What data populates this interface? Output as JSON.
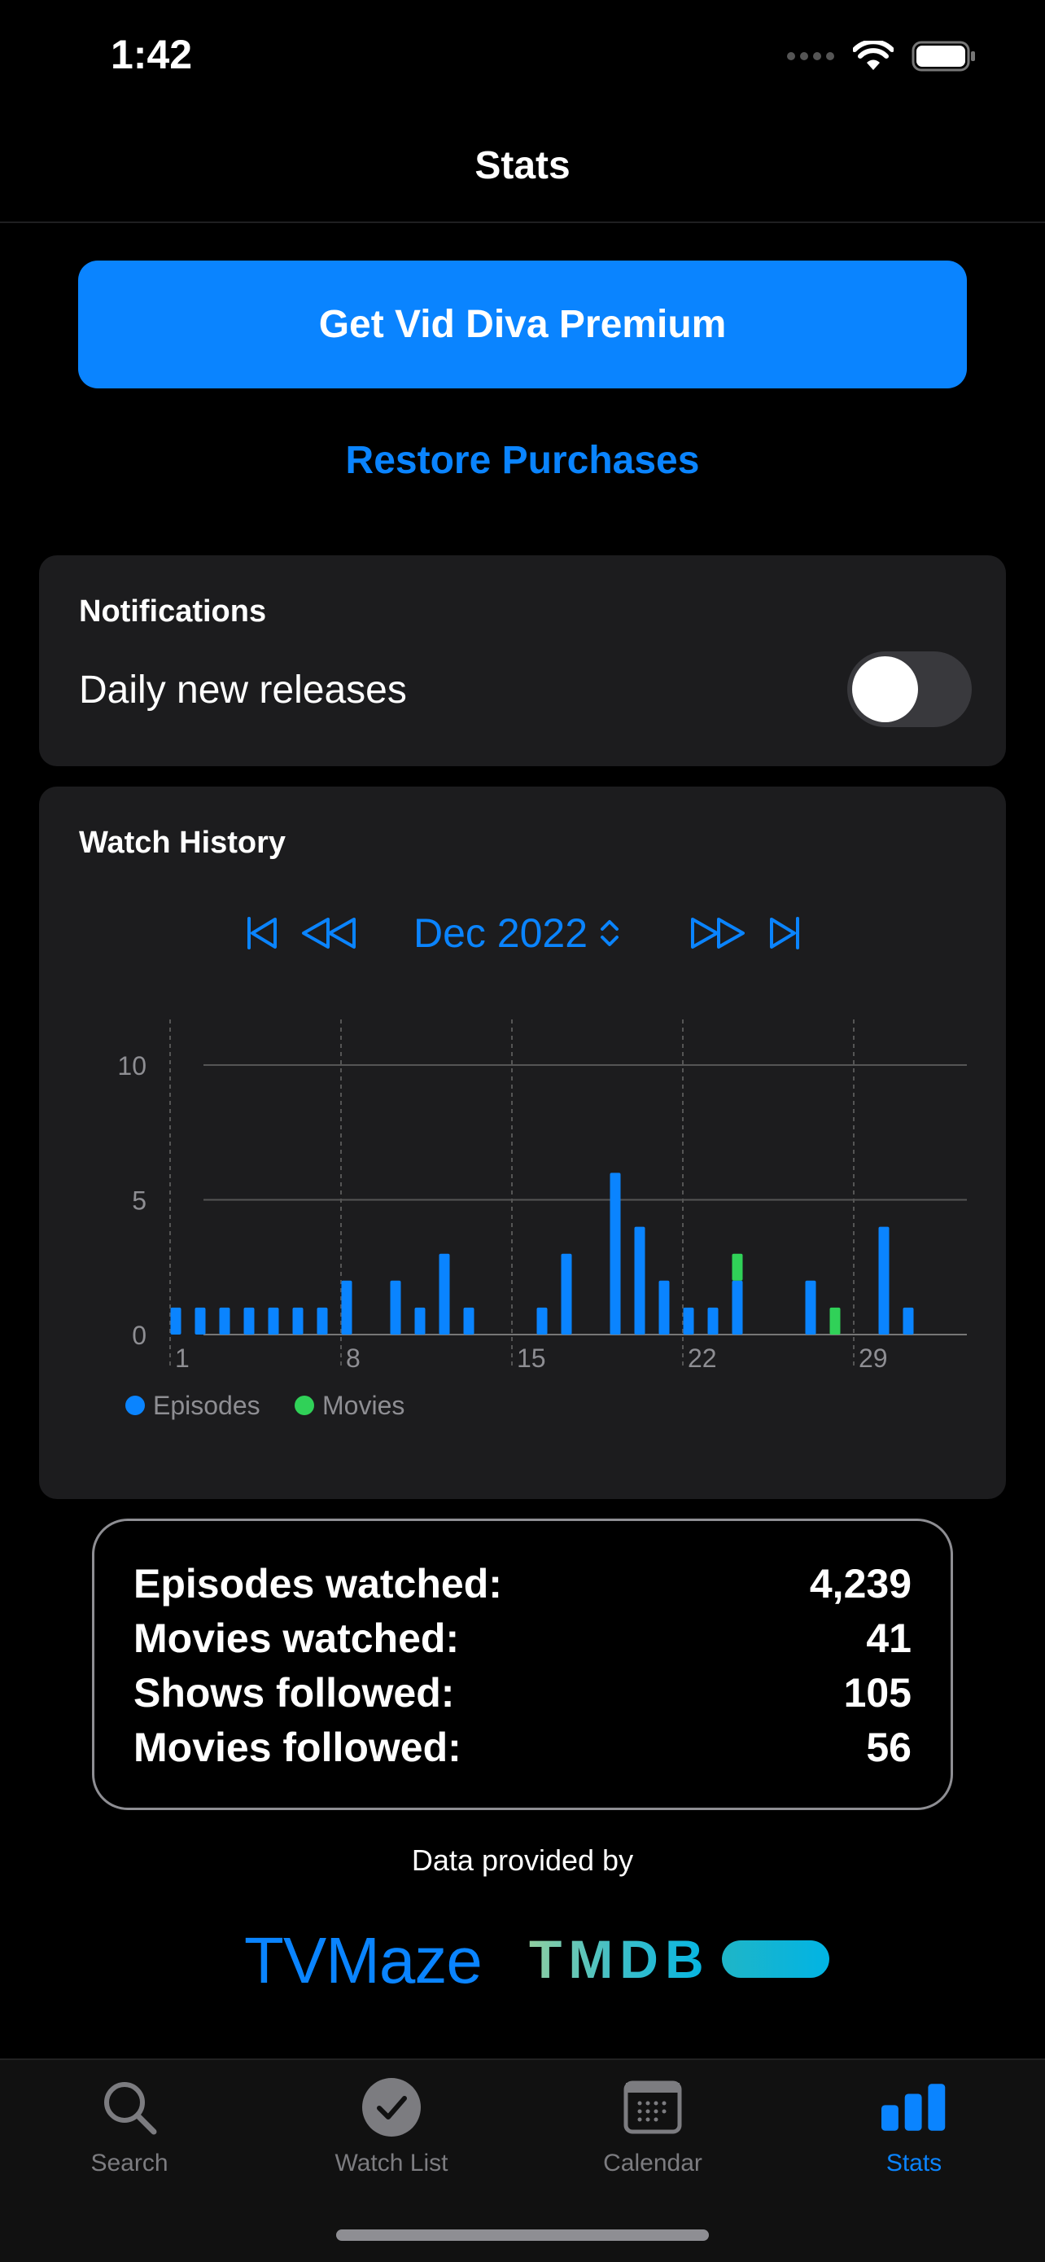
{
  "status_bar": {
    "time": "1:42"
  },
  "nav": {
    "title": "Stats"
  },
  "premium": {
    "button_label": "Get Vid Diva Premium",
    "restore_label": "Restore Purchases"
  },
  "notifications": {
    "heading": "Notifications",
    "daily_label": "Daily new releases",
    "daily_enabled": false
  },
  "watch_history": {
    "heading": "Watch History",
    "month": "Dec 2022",
    "legend": [
      {
        "name": "Episodes",
        "color": "#0a84ff"
      },
      {
        "name": "Movies",
        "color": "#30d158"
      }
    ]
  },
  "chart_data": {
    "type": "bar",
    "stacked": true,
    "x": [
      1,
      2,
      3,
      4,
      5,
      6,
      7,
      8,
      9,
      10,
      11,
      12,
      13,
      14,
      15,
      16,
      17,
      18,
      19,
      20,
      21,
      22,
      23,
      24,
      25,
      26,
      27,
      28,
      29,
      30,
      31
    ],
    "x_ticks": [
      "1",
      "8",
      "15",
      "22",
      "29"
    ],
    "y_ticks": [
      "0",
      "5",
      "10"
    ],
    "ylim": [
      0,
      10
    ],
    "series": [
      {
        "name": "Episodes",
        "color": "#0a84ff",
        "values": [
          1,
          1,
          1,
          1,
          1,
          1,
          1,
          2,
          0,
          2,
          1,
          3,
          1,
          0,
          0,
          1,
          3,
          0,
          6,
          4,
          2,
          1,
          1,
          2,
          0,
          0,
          2,
          0,
          0,
          4,
          1
        ]
      },
      {
        "name": "Movies",
        "color": "#30d158",
        "values": [
          0,
          0,
          0,
          0,
          0,
          0,
          0,
          0,
          0,
          0,
          0,
          0,
          0,
          0,
          0,
          0,
          0,
          0,
          0,
          0,
          0,
          0,
          0,
          1,
          0,
          0,
          0,
          1,
          0,
          0,
          0
        ]
      }
    ],
    "legend_position": "bottom-left",
    "grid": true
  },
  "totals": [
    {
      "label": "Episodes watched:",
      "value": "4,239"
    },
    {
      "label": "Movies watched:",
      "value": "41"
    },
    {
      "label": "Shows followed:",
      "value": "105"
    },
    {
      "label": "Movies followed:",
      "value": "56"
    }
  ],
  "credits": {
    "label": "Data provided by",
    "tvmaze": "TVMaze",
    "tmdb": "TMDB"
  },
  "tabs": [
    {
      "label": "Search",
      "icon": "search-icon",
      "active": false
    },
    {
      "label": "Watch List",
      "icon": "checkmark-circle-icon",
      "active": false
    },
    {
      "label": "Calendar",
      "icon": "calendar-icon",
      "active": false
    },
    {
      "label": "Stats",
      "icon": "bar-chart-icon",
      "active": true
    }
  ]
}
